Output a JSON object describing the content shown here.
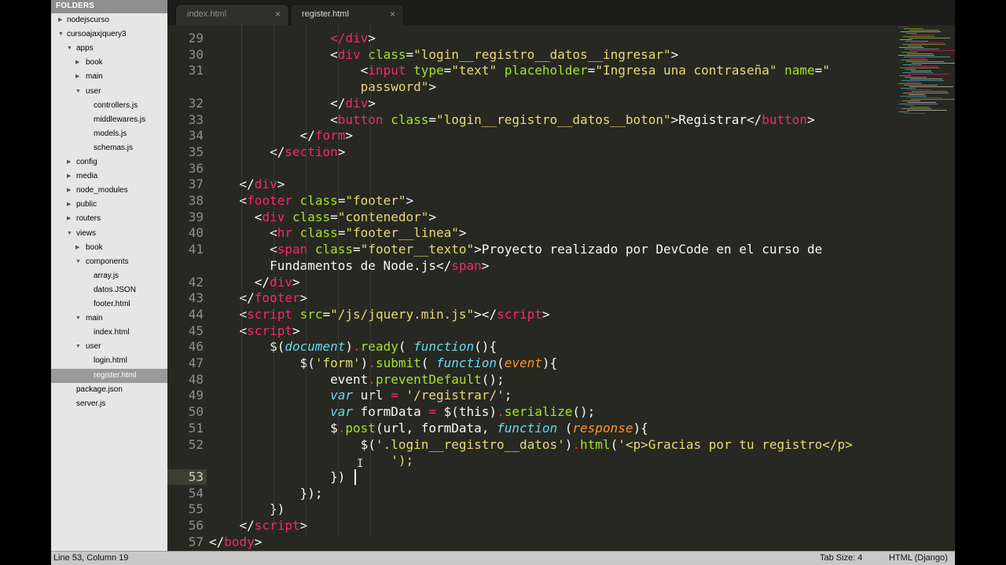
{
  "sidebar": {
    "header": "FOLDERS",
    "items": [
      {
        "label": "nodejscurso",
        "depth": 0,
        "arrow": "closed"
      },
      {
        "label": "cursoajaxjquery3",
        "depth": 0,
        "arrow": "open"
      },
      {
        "label": "apps",
        "depth": 1,
        "arrow": "open"
      },
      {
        "label": "book",
        "depth": 2,
        "arrow": "closed"
      },
      {
        "label": "main",
        "depth": 2,
        "arrow": "closed"
      },
      {
        "label": "user",
        "depth": 2,
        "arrow": "open"
      },
      {
        "label": "controllers.js",
        "depth": 3,
        "arrow": "none"
      },
      {
        "label": "middlewares.js",
        "depth": 3,
        "arrow": "none"
      },
      {
        "label": "models.js",
        "depth": 3,
        "arrow": "none"
      },
      {
        "label": "schemas.js",
        "depth": 3,
        "arrow": "none"
      },
      {
        "label": "config",
        "depth": 1,
        "arrow": "closed"
      },
      {
        "label": "media",
        "depth": 1,
        "arrow": "closed"
      },
      {
        "label": "node_modules",
        "depth": 1,
        "arrow": "closed"
      },
      {
        "label": "public",
        "depth": 1,
        "arrow": "closed"
      },
      {
        "label": "routers",
        "depth": 1,
        "arrow": "closed"
      },
      {
        "label": "views",
        "depth": 1,
        "arrow": "open"
      },
      {
        "label": "book",
        "depth": 2,
        "arrow": "closed"
      },
      {
        "label": "components",
        "depth": 2,
        "arrow": "open"
      },
      {
        "label": "array.js",
        "depth": 3,
        "arrow": "none"
      },
      {
        "label": "datos.JSON",
        "depth": 3,
        "arrow": "none"
      },
      {
        "label": "footer.html",
        "depth": 3,
        "arrow": "none"
      },
      {
        "label": "main",
        "depth": 2,
        "arrow": "open"
      },
      {
        "label": "index.html",
        "depth": 3,
        "arrow": "none"
      },
      {
        "label": "user",
        "depth": 2,
        "arrow": "open"
      },
      {
        "label": "login.html",
        "depth": 3,
        "arrow": "none"
      },
      {
        "label": "register.html",
        "depth": 3,
        "arrow": "none",
        "selected": true
      },
      {
        "label": "package.json",
        "depth": 1,
        "arrow": "none"
      },
      {
        "label": "server.js",
        "depth": 1,
        "arrow": "none"
      }
    ]
  },
  "tabs": [
    {
      "label": "index.html",
      "close": "×",
      "active": false
    },
    {
      "label": "register.html",
      "close": "×",
      "active": true
    }
  ],
  "editor": {
    "current_line": 53,
    "lines": [
      {
        "n": "29",
        "indent": 0,
        "tokens": [
          [
            "                </",
            "t"
          ],
          [
            "div",
            "t"
          ],
          [
            ">",
            "p"
          ]
        ]
      },
      {
        "n": "30",
        "indent": 0,
        "tokens": [
          [
            "                <",
            "p"
          ],
          [
            "div",
            "t"
          ],
          [
            " class",
            "a"
          ],
          [
            "=",
            "p"
          ],
          [
            "\"login__registro__datos__ingresar\"",
            "s"
          ],
          [
            ">",
            "p"
          ]
        ]
      },
      {
        "n": "31",
        "indent": 0,
        "tokens": [
          [
            "                    <",
            "p"
          ],
          [
            "input",
            "t"
          ],
          [
            " type",
            "a"
          ],
          [
            "=",
            "p"
          ],
          [
            "\"text\"",
            "s"
          ],
          [
            " placeholder",
            "a"
          ],
          [
            "=",
            "p"
          ],
          [
            "\"Ingresa una contraseña\"",
            "s"
          ],
          [
            " name",
            "a"
          ],
          [
            "=",
            "p"
          ],
          [
            "\"",
            "s"
          ]
        ]
      },
      {
        "n": "",
        "indent": 0,
        "tokens": [
          [
            "                    password\"",
            "s"
          ],
          [
            ">",
            "p"
          ]
        ]
      },
      {
        "n": "32",
        "indent": 0,
        "tokens": [
          [
            "                </",
            "p"
          ],
          [
            "div",
            "t"
          ],
          [
            ">",
            "p"
          ]
        ]
      },
      {
        "n": "33",
        "indent": 0,
        "tokens": [
          [
            "                <",
            "p"
          ],
          [
            "button",
            "t"
          ],
          [
            " class",
            "a"
          ],
          [
            "=",
            "p"
          ],
          [
            "\"login__registro__datos__boton\"",
            "s"
          ],
          [
            ">Registrar</",
            "p"
          ],
          [
            "button",
            "t"
          ],
          [
            ">",
            "p"
          ]
        ]
      },
      {
        "n": "34",
        "indent": 0,
        "tokens": [
          [
            "            </",
            "p"
          ],
          [
            "form",
            "t"
          ],
          [
            ">",
            "p"
          ]
        ]
      },
      {
        "n": "35",
        "indent": 0,
        "tokens": [
          [
            "        </",
            "p"
          ],
          [
            "section",
            "t"
          ],
          [
            ">",
            "p"
          ]
        ]
      },
      {
        "n": "36",
        "indent": 0,
        "tokens": [
          [
            "",
            "p"
          ]
        ]
      },
      {
        "n": "37",
        "indent": 0,
        "tokens": [
          [
            "    </",
            "p"
          ],
          [
            "div",
            "t"
          ],
          [
            ">",
            "p"
          ]
        ]
      },
      {
        "n": "38",
        "indent": 0,
        "tokens": [
          [
            "    <",
            "p"
          ],
          [
            "footer",
            "t"
          ],
          [
            " class",
            "a"
          ],
          [
            "=",
            "p"
          ],
          [
            "\"footer\"",
            "s"
          ],
          [
            ">",
            "p"
          ]
        ]
      },
      {
        "n": "39",
        "indent": 0,
        "tokens": [
          [
            "      <",
            "p"
          ],
          [
            "div",
            "t"
          ],
          [
            " class",
            "a"
          ],
          [
            "=",
            "p"
          ],
          [
            "\"contenedor\"",
            "s"
          ],
          [
            ">",
            "p"
          ]
        ]
      },
      {
        "n": "40",
        "indent": 0,
        "tokens": [
          [
            "        <",
            "p"
          ],
          [
            "hr",
            "t"
          ],
          [
            " class",
            "a"
          ],
          [
            "=",
            "p"
          ],
          [
            "\"footer__linea\"",
            "s"
          ],
          [
            ">",
            "p"
          ]
        ]
      },
      {
        "n": "41",
        "indent": 0,
        "tokens": [
          [
            "        <",
            "p"
          ],
          [
            "span",
            "t"
          ],
          [
            " class",
            "a"
          ],
          [
            "=",
            "p"
          ],
          [
            "\"footer__texto\"",
            "s"
          ],
          [
            ">Proyecto realizado por DevCode en el curso de",
            "p"
          ]
        ]
      },
      {
        "n": "",
        "indent": 0,
        "tokens": [
          [
            "        Fundamentos de Node.js</",
            "p"
          ],
          [
            "span",
            "t"
          ],
          [
            ">",
            "p"
          ]
        ]
      },
      {
        "n": "42",
        "indent": 0,
        "tokens": [
          [
            "      </",
            "p"
          ],
          [
            "div",
            "t"
          ],
          [
            ">",
            "p"
          ]
        ]
      },
      {
        "n": "43",
        "indent": 0,
        "tokens": [
          [
            "    </",
            "p"
          ],
          [
            "footer",
            "t"
          ],
          [
            ">",
            "p"
          ]
        ]
      },
      {
        "n": "44",
        "indent": 0,
        "tokens": [
          [
            "    <",
            "p"
          ],
          [
            "script",
            "t"
          ],
          [
            " src",
            "a"
          ],
          [
            "=",
            "p"
          ],
          [
            "\"/js/jquery.min.js\"",
            "s"
          ],
          [
            "></",
            "p"
          ],
          [
            "script",
            "t"
          ],
          [
            ">",
            "p"
          ]
        ]
      },
      {
        "n": "45",
        "indent": 0,
        "tokens": [
          [
            "    <",
            "p"
          ],
          [
            "script",
            "t"
          ],
          [
            ">",
            "p"
          ]
        ]
      },
      {
        "n": "46",
        "indent": 0,
        "tokens": [
          [
            "        $(",
            "p"
          ],
          [
            "document",
            "k"
          ],
          [
            ")",
            "p"
          ],
          [
            ".",
            "t"
          ],
          [
            "ready",
            "f"
          ],
          [
            "( ",
            "p"
          ],
          [
            "function",
            "k"
          ],
          [
            "(){",
            "p"
          ]
        ]
      },
      {
        "n": "47",
        "indent": 0,
        "tokens": [
          [
            "            $(",
            "p"
          ],
          [
            "'form'",
            "s"
          ],
          [
            ")",
            "p"
          ],
          [
            ".",
            "t"
          ],
          [
            "submit",
            "f"
          ],
          [
            "( ",
            "p"
          ],
          [
            "function",
            "k"
          ],
          [
            "(",
            "p"
          ],
          [
            "event",
            "v"
          ],
          [
            "){",
            "p"
          ]
        ]
      },
      {
        "n": "48",
        "indent": 0,
        "tokens": [
          [
            "                event",
            "p"
          ],
          [
            ".",
            "t"
          ],
          [
            "preventDefault",
            "f"
          ],
          [
            "();",
            "p"
          ]
        ]
      },
      {
        "n": "49",
        "indent": 0,
        "tokens": [
          [
            "                ",
            "p"
          ],
          [
            "var",
            "k"
          ],
          [
            " url ",
            "p"
          ],
          [
            "=",
            "t"
          ],
          [
            " ",
            "p"
          ],
          [
            "'/registrar/'",
            "s"
          ],
          [
            ";",
            "p"
          ]
        ]
      },
      {
        "n": "50",
        "indent": 0,
        "tokens": [
          [
            "                ",
            "p"
          ],
          [
            "var",
            "k"
          ],
          [
            " formData ",
            "p"
          ],
          [
            "=",
            "t"
          ],
          [
            " $(this)",
            "p"
          ],
          [
            ".",
            "t"
          ],
          [
            "serialize",
            "f"
          ],
          [
            "();",
            "p"
          ]
        ]
      },
      {
        "n": "51",
        "indent": 0,
        "tokens": [
          [
            "                $",
            "p"
          ],
          [
            ".",
            "t"
          ],
          [
            "post",
            "f"
          ],
          [
            "(url, formData, ",
            "p"
          ],
          [
            "function",
            "k"
          ],
          [
            " (",
            "p"
          ],
          [
            "response",
            "v"
          ],
          [
            "){",
            "p"
          ]
        ]
      },
      {
        "n": "52",
        "indent": 0,
        "tokens": [
          [
            "                    $(",
            "p"
          ],
          [
            "'.login__registro__datos'",
            "s"
          ],
          [
            ")",
            "p"
          ],
          [
            ".",
            "t"
          ],
          [
            "html",
            "f"
          ],
          [
            "(",
            "p"
          ],
          [
            "'<p>Gracias por tu registro</p>",
            "s"
          ]
        ]
      },
      {
        "n": "",
        "indent": 0,
        "tokens": [
          [
            "                        ');",
            "s"
          ]
        ]
      },
      {
        "n": "53",
        "indent": 0,
        "tokens": [
          [
            "                })",
            "p"
          ]
        ]
      },
      {
        "n": "54",
        "indent": 0,
        "tokens": [
          [
            "            });",
            "p"
          ]
        ]
      },
      {
        "n": "55",
        "indent": 0,
        "tokens": [
          [
            "        })",
            "p"
          ]
        ]
      },
      {
        "n": "56",
        "indent": 0,
        "tokens": [
          [
            "    </",
            "p"
          ],
          [
            "script",
            "t"
          ],
          [
            ">",
            "p"
          ]
        ]
      },
      {
        "n": "57",
        "indent": 0,
        "tokens": [
          [
            "</",
            "p"
          ],
          [
            "body",
            "t"
          ],
          [
            ">",
            "p"
          ]
        ]
      }
    ]
  },
  "status": {
    "position": "Line 53, Column 19",
    "tab_size": "Tab Size: 4",
    "syntax": "HTML (Django)"
  },
  "colors": {
    "editor_bg": "#272822",
    "tag": "#f92672",
    "attr": "#a6e22e",
    "string": "#e6db74",
    "keyword": "#66d9ef",
    "param": "#fd971f"
  }
}
